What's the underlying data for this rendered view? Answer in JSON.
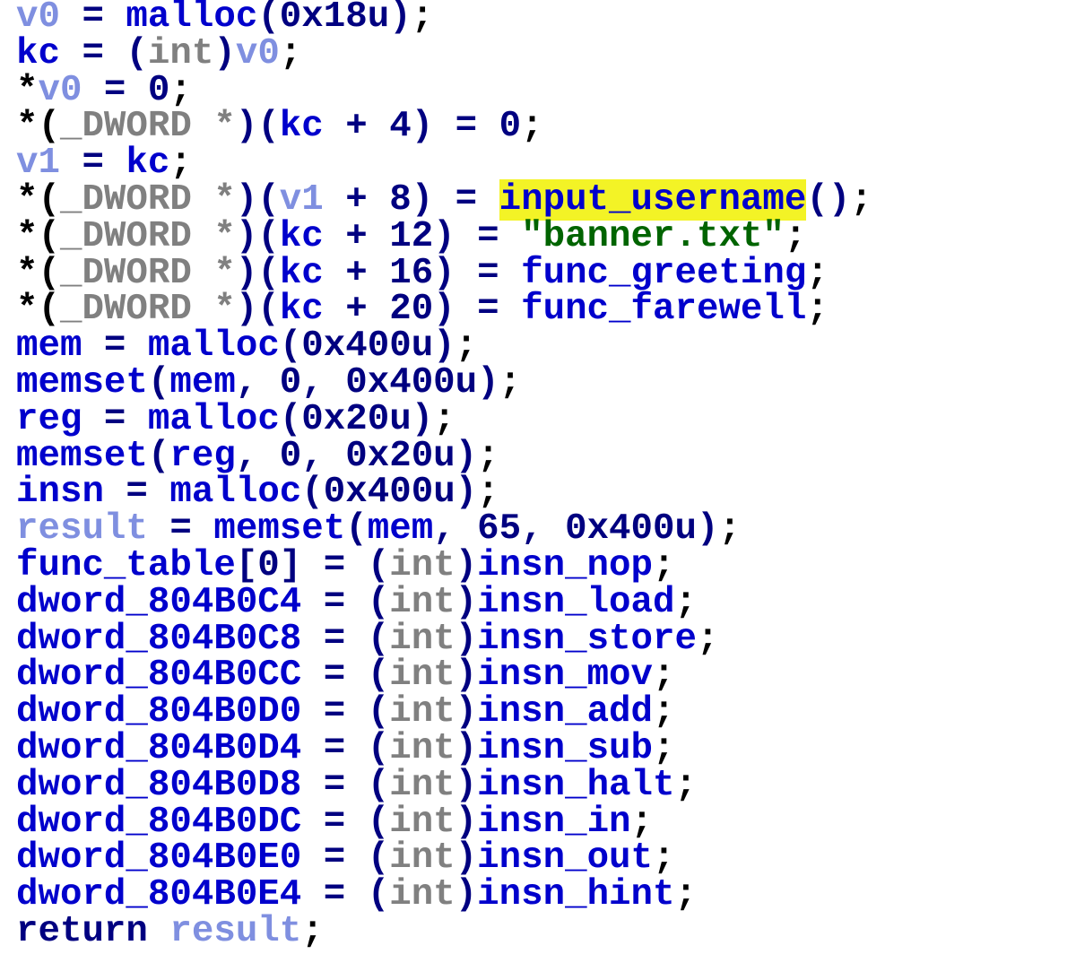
{
  "code_view": {
    "lines": [
      [
        [
          "v0",
          "local"
        ],
        [
          " = ",
          "op"
        ],
        [
          "malloc",
          "id"
        ],
        [
          "(0x18u)",
          "op"
        ],
        [
          ";",
          "punc"
        ]
      ],
      [
        [
          "kc",
          "id"
        ],
        [
          " = (",
          "op"
        ],
        [
          "int",
          "type"
        ],
        [
          ")",
          "op"
        ],
        [
          "v0",
          "local"
        ],
        [
          ";",
          "punc"
        ]
      ],
      [
        [
          "*",
          "punc"
        ],
        [
          "v0",
          "local"
        ],
        [
          " = 0",
          "op"
        ],
        [
          ";",
          "punc"
        ]
      ],
      [
        [
          "*(",
          "punc"
        ],
        [
          "_DWORD *",
          "type"
        ],
        [
          ")(",
          "op"
        ],
        [
          "kc",
          "id"
        ],
        [
          " + 4) = 0",
          "op"
        ],
        [
          ";",
          "punc"
        ]
      ],
      [
        [
          "v1",
          "local"
        ],
        [
          " = ",
          "op"
        ],
        [
          "kc",
          "id"
        ],
        [
          ";",
          "punc"
        ]
      ],
      [
        [
          "*(",
          "punc"
        ],
        [
          "_DWORD *",
          "type"
        ],
        [
          ")(",
          "op"
        ],
        [
          "v1",
          "local"
        ],
        [
          " + 8) = ",
          "op"
        ],
        [
          "input_username",
          "hl"
        ],
        [
          "()",
          "op"
        ],
        [
          ";",
          "punc"
        ]
      ],
      [
        [
          "*(",
          "punc"
        ],
        [
          "_DWORD *",
          "type"
        ],
        [
          ")(",
          "op"
        ],
        [
          "kc",
          "id"
        ],
        [
          " + 12) = ",
          "op"
        ],
        [
          "\"banner.txt\"",
          "str"
        ],
        [
          ";",
          "punc"
        ]
      ],
      [
        [
          "*(",
          "punc"
        ],
        [
          "_DWORD *",
          "type"
        ],
        [
          ")(",
          "op"
        ],
        [
          "kc",
          "id"
        ],
        [
          " + 16) = ",
          "op"
        ],
        [
          "func_greeting",
          "id"
        ],
        [
          ";",
          "punc"
        ]
      ],
      [
        [
          "*(",
          "punc"
        ],
        [
          "_DWORD *",
          "type"
        ],
        [
          ")(",
          "op"
        ],
        [
          "kc",
          "id"
        ],
        [
          " + 20) = ",
          "op"
        ],
        [
          "func_farewell",
          "id"
        ],
        [
          ";",
          "punc"
        ]
      ],
      [
        [
          "mem",
          "id"
        ],
        [
          " = ",
          "op"
        ],
        [
          "malloc",
          "id"
        ],
        [
          "(0x400u)",
          "op"
        ],
        [
          ";",
          "punc"
        ]
      ],
      [
        [
          "memset",
          "id"
        ],
        [
          "(",
          "op"
        ],
        [
          "mem",
          "id"
        ],
        [
          ", 0, 0x400u)",
          "op"
        ],
        [
          ";",
          "punc"
        ]
      ],
      [
        [
          "reg",
          "id"
        ],
        [
          " = ",
          "op"
        ],
        [
          "malloc",
          "id"
        ],
        [
          "(0x20u)",
          "op"
        ],
        [
          ";",
          "punc"
        ]
      ],
      [
        [
          "memset",
          "id"
        ],
        [
          "(",
          "op"
        ],
        [
          "reg",
          "id"
        ],
        [
          ", 0, 0x20u)",
          "op"
        ],
        [
          ";",
          "punc"
        ]
      ],
      [
        [
          "insn",
          "id"
        ],
        [
          " = ",
          "op"
        ],
        [
          "malloc",
          "id"
        ],
        [
          "(0x400u)",
          "op"
        ],
        [
          ";",
          "punc"
        ]
      ],
      [
        [
          "result",
          "local"
        ],
        [
          " = ",
          "op"
        ],
        [
          "memset",
          "id"
        ],
        [
          "(",
          "op"
        ],
        [
          "mem",
          "id"
        ],
        [
          ", 65, 0x400u)",
          "op"
        ],
        [
          ";",
          "punc"
        ]
      ],
      [
        [
          "func_table",
          "id"
        ],
        [
          "[0] = (",
          "op"
        ],
        [
          "int",
          "type"
        ],
        [
          ")",
          "op"
        ],
        [
          "insn_nop",
          "id"
        ],
        [
          ";",
          "punc"
        ]
      ],
      [
        [
          "dword_804B0C4",
          "id"
        ],
        [
          " = (",
          "op"
        ],
        [
          "int",
          "type"
        ],
        [
          ")",
          "op"
        ],
        [
          "insn_load",
          "id"
        ],
        [
          ";",
          "punc"
        ]
      ],
      [
        [
          "dword_804B0C8",
          "id"
        ],
        [
          " = (",
          "op"
        ],
        [
          "int",
          "type"
        ],
        [
          ")",
          "op"
        ],
        [
          "insn_store",
          "id"
        ],
        [
          ";",
          "punc"
        ]
      ],
      [
        [
          "dword_804B0CC",
          "id"
        ],
        [
          " = (",
          "op"
        ],
        [
          "int",
          "type"
        ],
        [
          ")",
          "op"
        ],
        [
          "insn_mov",
          "id"
        ],
        [
          ";",
          "punc"
        ]
      ],
      [
        [
          "dword_804B0D0",
          "id"
        ],
        [
          " = (",
          "op"
        ],
        [
          "int",
          "type"
        ],
        [
          ")",
          "op"
        ],
        [
          "insn_add",
          "id"
        ],
        [
          ";",
          "punc"
        ]
      ],
      [
        [
          "dword_804B0D4",
          "id"
        ],
        [
          " = (",
          "op"
        ],
        [
          "int",
          "type"
        ],
        [
          ")",
          "op"
        ],
        [
          "insn_sub",
          "id"
        ],
        [
          ";",
          "punc"
        ]
      ],
      [
        [
          "dword_804B0D8",
          "id"
        ],
        [
          " = (",
          "op"
        ],
        [
          "int",
          "type"
        ],
        [
          ")",
          "op"
        ],
        [
          "insn_halt",
          "id"
        ],
        [
          ";",
          "punc"
        ]
      ],
      [
        [
          "dword_804B0DC",
          "id"
        ],
        [
          " = (",
          "op"
        ],
        [
          "int",
          "type"
        ],
        [
          ")",
          "op"
        ],
        [
          "insn_in",
          "id"
        ],
        [
          ";",
          "punc"
        ]
      ],
      [
        [
          "dword_804B0E0",
          "id"
        ],
        [
          " = (",
          "op"
        ],
        [
          "int",
          "type"
        ],
        [
          ")",
          "op"
        ],
        [
          "insn_out",
          "id"
        ],
        [
          ";",
          "punc"
        ]
      ],
      [
        [
          "dword_804B0E4",
          "id"
        ],
        [
          " = (",
          "op"
        ],
        [
          "int",
          "type"
        ],
        [
          ")",
          "op"
        ],
        [
          "insn_hint",
          "id"
        ],
        [
          ";",
          "punc"
        ]
      ],
      [
        [
          "return ",
          "kw"
        ],
        [
          "result",
          "local"
        ],
        [
          ";",
          "punc"
        ]
      ]
    ],
    "colors": {
      "identifier": "#0000cc",
      "local_variable": "#7f8fe0",
      "type_cast": "#808080",
      "operator": "#000080",
      "punctuation": "#000000",
      "string": "#006400",
      "highlight_background": "#f3f326",
      "background": "#ffffff"
    }
  }
}
